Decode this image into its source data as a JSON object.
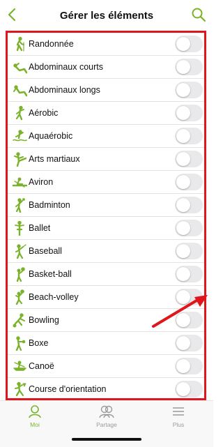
{
  "header": {
    "title": "Gérer les éléments",
    "back_icon": "chevron-left-icon",
    "search_icon": "search-icon"
  },
  "colors": {
    "accent": "#7ab32a",
    "annotation_red": "#e0161d",
    "toggle_off": "#e9e9eb"
  },
  "items": [
    {
      "label": "Randonnée",
      "icon": "hiking-icon",
      "enabled": false
    },
    {
      "label": "Abdominaux courts",
      "icon": "crunches-icon",
      "enabled": false
    },
    {
      "label": "Abdominaux longs",
      "icon": "situps-icon",
      "enabled": false
    },
    {
      "label": "Aérobic",
      "icon": "aerobics-icon",
      "enabled": false
    },
    {
      "label": "Aquaérobic",
      "icon": "aqua-aerobics-icon",
      "enabled": false
    },
    {
      "label": "Arts martiaux",
      "icon": "martial-arts-icon",
      "enabled": false
    },
    {
      "label": "Aviron",
      "icon": "rowing-icon",
      "enabled": false
    },
    {
      "label": "Badminton",
      "icon": "badminton-icon",
      "enabled": false
    },
    {
      "label": "Ballet",
      "icon": "ballet-icon",
      "enabled": false
    },
    {
      "label": "Baseball",
      "icon": "baseball-icon",
      "enabled": false
    },
    {
      "label": "Basket-ball",
      "icon": "basketball-icon",
      "enabled": false
    },
    {
      "label": "Beach-volley",
      "icon": "beach-volley-icon",
      "enabled": false
    },
    {
      "label": "Bowling",
      "icon": "bowling-icon",
      "enabled": false
    },
    {
      "label": "Boxe",
      "icon": "boxing-icon",
      "enabled": false
    },
    {
      "label": "Canoë",
      "icon": "canoe-icon",
      "enabled": false
    },
    {
      "label": "Course d'orientation",
      "icon": "orienteering-icon",
      "enabled": false
    }
  ],
  "tabbar": {
    "tabs": [
      {
        "label": "Moi",
        "icon": "person-icon",
        "active": true
      },
      {
        "label": "Partage",
        "icon": "people-icon",
        "active": false
      },
      {
        "label": "Plus",
        "icon": "menu-icon",
        "active": false
      }
    ]
  }
}
